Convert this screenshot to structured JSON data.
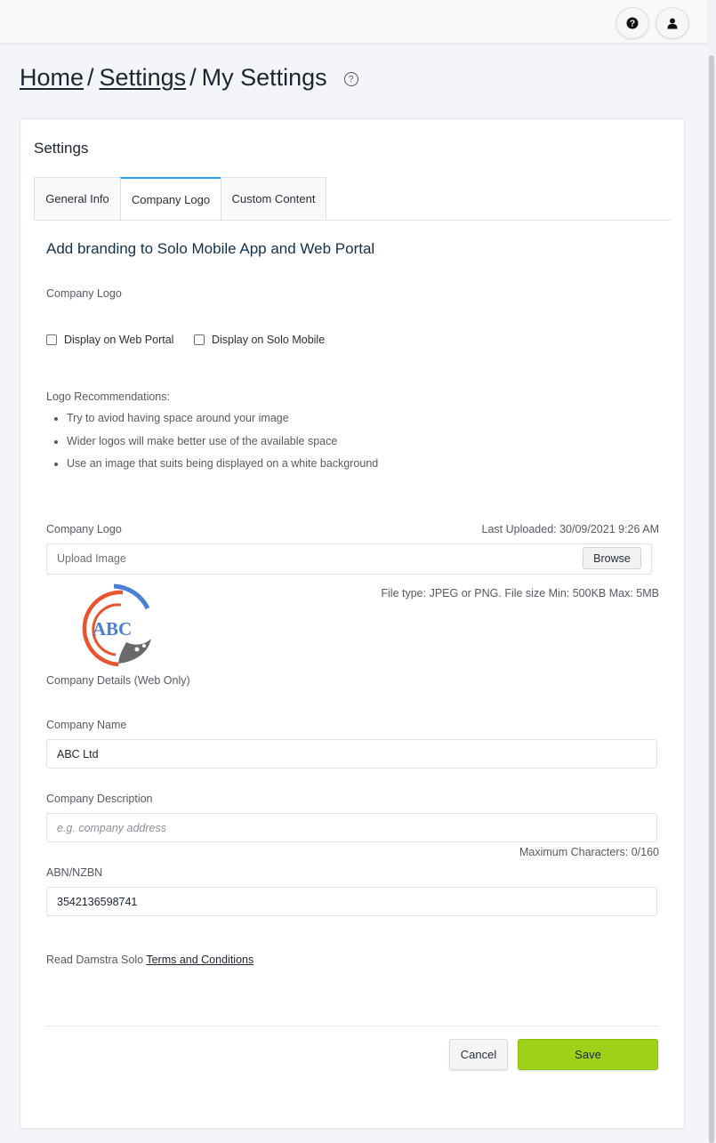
{
  "header": {
    "help_icon": "question-circle-icon",
    "user_icon": "user-icon"
  },
  "breadcrumb": {
    "home": "Home",
    "settings": "Settings",
    "current": "My Settings",
    "separator": "/"
  },
  "card": {
    "title": "Settings",
    "tabs": [
      {
        "label": "General Info"
      },
      {
        "label": "Company Logo",
        "active": true
      },
      {
        "label": "Custom Content"
      }
    ]
  },
  "branding": {
    "title": "Add branding to Solo Mobile App and Web Portal",
    "company_logo_label": "Company Logo",
    "display_web_portal": "Display on Web Portal",
    "display_solo_mobile": "Display on Solo Mobile",
    "recommendations_title": "Logo Recommendations:",
    "recommendations": [
      "Try to aviod having space around your image",
      "Wider logos will make better use of the available space",
      "Use an image that suits being displayed on a white background"
    ],
    "upload_label": "Company Logo",
    "last_uploaded": "Last Uploaded: 30/09/2021 9:26 AM",
    "upload_placeholder": "Upload Image",
    "browse_label": "Browse",
    "file_hint": "File type: JPEG or PNG. File size Min: 500KB Max: 5MB",
    "logo_text": "ABC"
  },
  "company": {
    "details_label": "Company Details (Web Only)",
    "name_label": "Company Name",
    "name_value": "ABC Ltd",
    "description_label": "Company Description",
    "description_placeholder": "e.g. company address",
    "max_chars": "Maximum Characters: 0/160",
    "abn_label": "ABN/NZBN",
    "abn_value": "3542136598741"
  },
  "terms": {
    "prefix": "Read Damstra Solo",
    "link": "Terms and Conditions"
  },
  "actions": {
    "cancel": "Cancel",
    "save": "Save"
  },
  "colors": {
    "accent_tab": "#2a9df4",
    "save_button": "#9fd119",
    "logo_orange": "#e8542d",
    "logo_blue": "#4a7fd6",
    "logo_gray": "#6a6a6a"
  }
}
